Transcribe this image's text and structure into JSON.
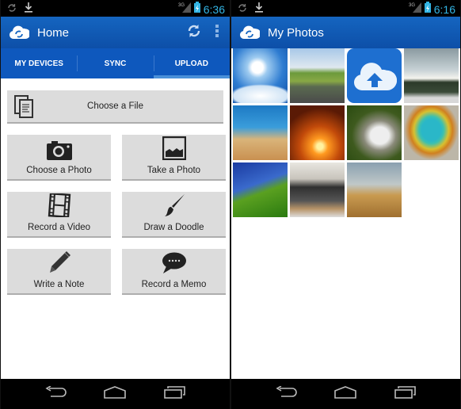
{
  "left_screen": {
    "status_bar": {
      "time": "6:36",
      "network": "3G",
      "icons": [
        "sync-icon",
        "download-icon",
        "signal-icon",
        "battery-charging-icon"
      ]
    },
    "action_bar": {
      "title": "Home",
      "logo": "cloud-sync-logo",
      "actions": [
        "refresh-icon",
        "overflow-menu-icon"
      ]
    },
    "tabs": [
      {
        "label": "MY DEVICES",
        "active": false
      },
      {
        "label": "SYNC",
        "active": false
      },
      {
        "label": "UPLOAD",
        "active": true
      }
    ],
    "upload_options": {
      "choose_file": "Choose a File",
      "choose_photo": "Choose a Photo",
      "take_photo": "Take a Photo",
      "record_video": "Record a Video",
      "draw_doodle": "Draw a Doodle",
      "write_note": "Write a Note",
      "record_memo": "Record a Memo"
    }
  },
  "right_screen": {
    "status_bar": {
      "time": "6:16",
      "network": "3G"
    },
    "action_bar": {
      "title": "My Photos"
    },
    "photos": [
      "sky-clouds",
      "country-road",
      "cloud-upload-app-icon",
      "winter-tree",
      "desert-car",
      "sunset",
      "hedgehog",
      "hot-spring",
      "grass",
      "office-phone",
      "wheat"
    ]
  },
  "nav_bar": {
    "buttons": [
      "back",
      "home",
      "recent-apps"
    ]
  },
  "colors": {
    "action_bar": "#1565c0",
    "tab_bar": "#0e58bd",
    "status_accent": "#33b5e5",
    "button_bg": "#dcdcdc"
  }
}
